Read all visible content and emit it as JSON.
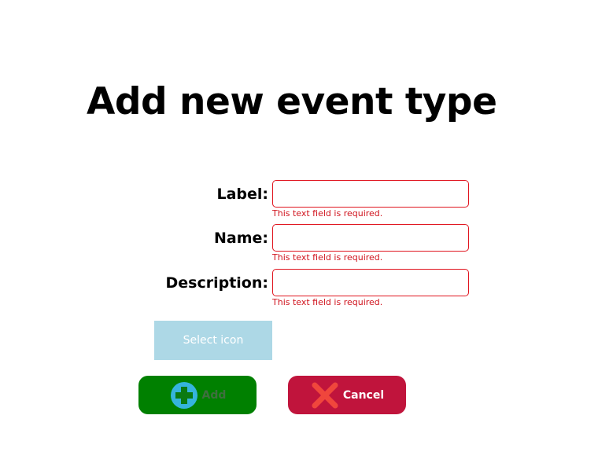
{
  "page": {
    "title": "Add new event type"
  },
  "form": {
    "fields": [
      {
        "label": "Label:",
        "value": "",
        "error": "This text field is required."
      },
      {
        "label": "Name:",
        "value": "",
        "error": "This text field is required."
      },
      {
        "label": "Description:",
        "value": "",
        "error": "This text field is required."
      }
    ],
    "select_icon_label": "Select icon"
  },
  "actions": {
    "add_label": "Add",
    "cancel_label": "Cancel"
  },
  "colors": {
    "error": "#e0141e",
    "select_icon_bg": "#add8e6",
    "add_bg": "#008000",
    "add_icon": "#35b4dc",
    "cancel_bg": "#c0143c",
    "cancel_icon": "#f0463c"
  },
  "icons": {
    "add": "plus-circle-icon",
    "cancel": "x-icon"
  }
}
